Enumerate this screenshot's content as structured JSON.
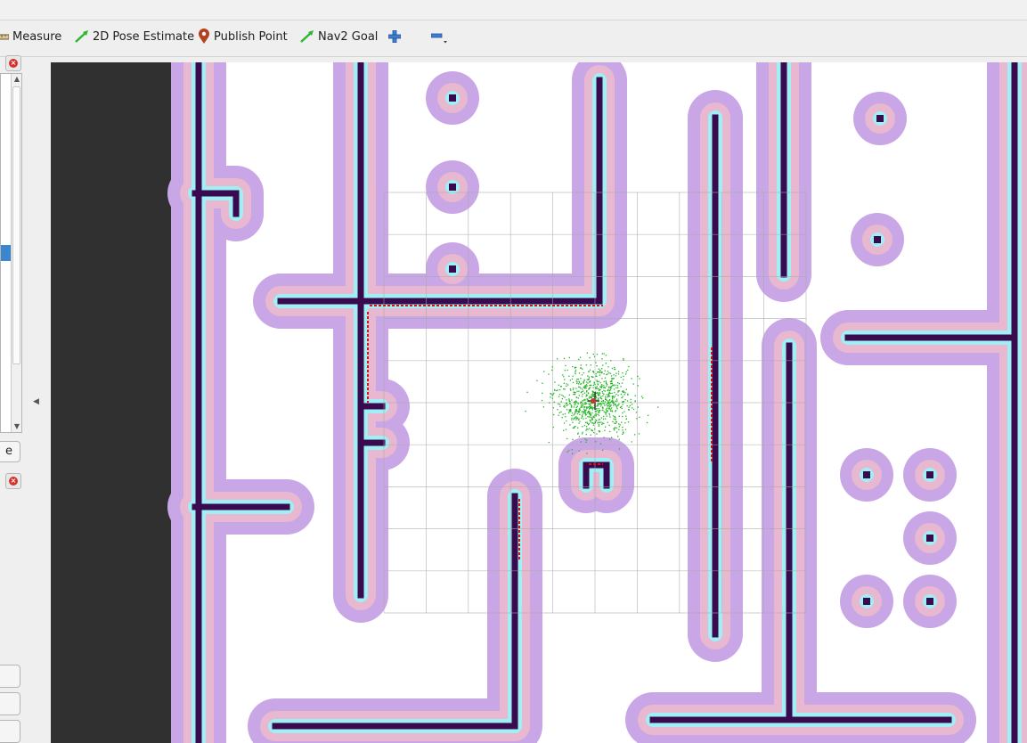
{
  "toolbar": {
    "tools": [
      {
        "id": "measure",
        "label": "Measure",
        "icon": "ruler-icon"
      },
      {
        "id": "pose",
        "label": "2D Pose Estimate",
        "icon": "green-arrow-icon"
      },
      {
        "id": "publish",
        "label": "Publish Point",
        "icon": "map-pin-icon"
      },
      {
        "id": "nav2",
        "label": "Nav2 Goal",
        "icon": "green-arrow-icon"
      }
    ],
    "add_icon": "plus-icon",
    "remove_icon": "minus-icon"
  },
  "left_panel": {
    "partial_button_label": "e"
  },
  "map": {
    "colors": {
      "background": "#303030",
      "free": "#ffffff",
      "inflation_outer": "#c9a7e6",
      "inflation_mid": "#e8b7d0",
      "inflation_inner": "#9ff0f4",
      "obstacle": "#3a0a4e",
      "laser": "#e01010",
      "particles": "#22b422",
      "grid": "#a8a8a8"
    }
  }
}
